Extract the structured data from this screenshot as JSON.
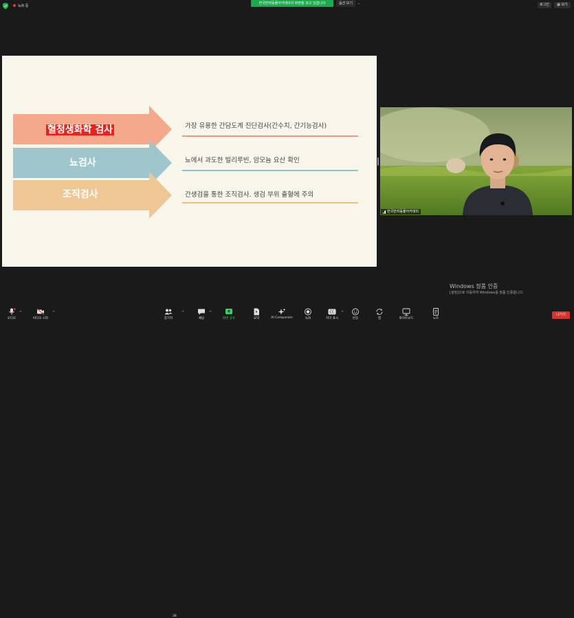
{
  "topbar": {
    "recording_label": "녹화 중",
    "share_banner": "한국반려동물아카데미의 화면을 보고 있습니다",
    "view_options_label": "옵션 보기",
    "view_options_chevron": "⌄",
    "logout_label": "로그인",
    "view_label": "보기",
    "colors": {
      "share_banner": "#1ea94f",
      "record_dot": "#e0403a"
    }
  },
  "slide": {
    "items": [
      {
        "title": "혈청생화학 검사",
        "highlighted": true,
        "description": "가장 유용한 간담도계 진단검사(간수치, 간기능검사)",
        "color": "#f4a98c"
      },
      {
        "title": "뇨검사",
        "highlighted": false,
        "description": "뇨에서 과도한 빌리루빈, 암모늄 요산 확인",
        "color": "#9fc6cc"
      },
      {
        "title": "조직검사",
        "highlighted": false,
        "description": "간생검을 통한 조직검사. 생검 부위 출혈에 주의",
        "color": "#efc795"
      }
    ]
  },
  "camera": {
    "participant_name": "한국반려동물아카데미"
  },
  "watermark": {
    "title": "Windows 정품 인증",
    "subtitle": "[설정]으로 이동하여 Windows를 정품 인증합니다."
  },
  "toolbar": {
    "audio_label": "오디오",
    "video_label": "비디오 시작",
    "participants_label": "참가자",
    "participants_count": "38",
    "chat_label": "채팅",
    "share_label": "화면 공유",
    "summary_label": "요약",
    "ai_label": "AI Companion",
    "record_label": "녹화",
    "captions_label": "자막 표시",
    "reactions_label": "반응",
    "apps_label": "앱",
    "whiteboard_label": "화이트보드",
    "notes_label": "노트",
    "caret": "^",
    "end_label": "나가기",
    "colors": {
      "share_active": "#36d36a",
      "end_button": "#d9302c"
    }
  }
}
